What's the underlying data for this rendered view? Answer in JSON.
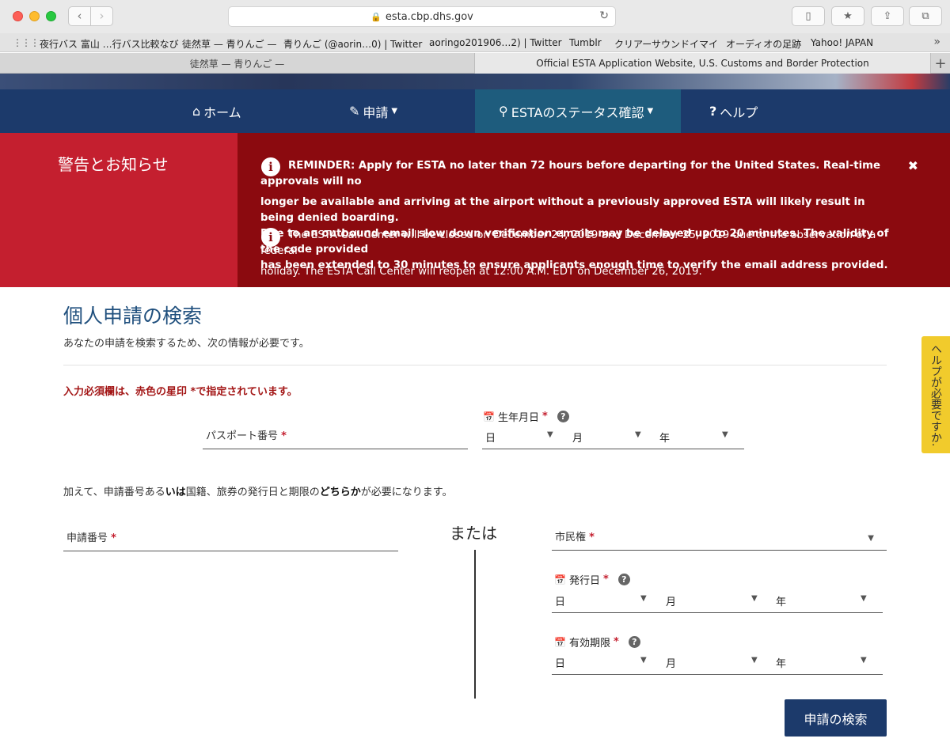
{
  "browser": {
    "url": "esta.cbp.dhs.gov",
    "bookmarks": [
      "夜行バス 富山 …行バス比較なび",
      "徒然草 — 青りんご —",
      "青りんご (@aorin…0) | Twitter",
      "aoringo201906…2) | Twitter",
      "Tumblr",
      "クリアーサウンドイマイ",
      "オーディオの足跡",
      "Yahoo! JAPAN"
    ],
    "tabs": [
      "徒然草 — 青りんご —",
      "Official ESTA Application Website, U.S. Customs and Border Protection"
    ]
  },
  "nav": {
    "home": "ホーム",
    "apply": "申請",
    "status": "ESTAのステータス確認",
    "help": "ヘルプ"
  },
  "alerts": {
    "heading": "警告とお知らせ",
    "reminder_lines": [
      "REMINDER: Apply for ESTA no later than 72 hours before departing for the United States. Real-time approvals will no",
      "longer be available and arriving at the airport without a previously approved ESTA will likely result in being denied boarding.",
      "Due to an outbound email slow down verification emails may be delayed up to 20 minutes. The validity of the code provided",
      "has been extended to 30 minutes to ensure applicants enough time to verify the email address provided."
    ],
    "callcenter_lines": [
      "The ESTA Call Center will be closed on December 24, 2019 and December 25, 2019 due to the observation of a federal",
      "holiday. The ESTA Call Center will reopen at 12:00 A.M. EDT on December 26, 2019."
    ]
  },
  "search": {
    "title": "個人申請の検索",
    "subtitle": "あなたの申請を検索するため、次の情報が必要です。",
    "required_note": "入力必須欄は、赤色の星印 *で指定されています。",
    "passport_label": "パスポート番号",
    "birthdate_label": "生年月日",
    "info_line_1": "加えて、申請番号ある",
    "info_line_or": "いは",
    "info_line_2": "国籍、旅券の発行日と期限の",
    "info_line_either": "どちらか",
    "info_line_3": "が必要になります。",
    "application_label": "申請番号",
    "or_text": "または",
    "citizenship_label": "市民権",
    "issue_label": "発行日",
    "expiry_label": "有効期限",
    "day": "日",
    "month": "月",
    "year": "年",
    "required_star": "*",
    "button": "申請の検索"
  },
  "help_tab": "ヘルプが必要ですか."
}
